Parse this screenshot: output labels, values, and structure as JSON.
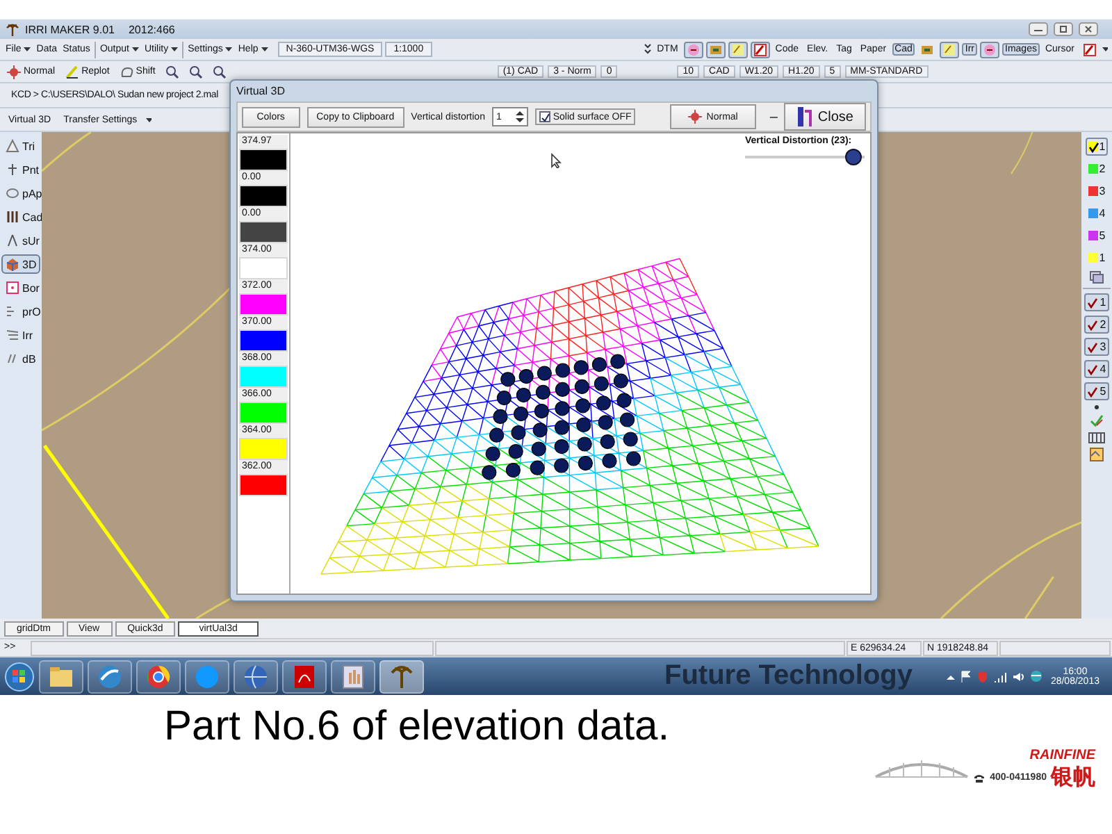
{
  "app": {
    "title": "IRRI MAKER  9.01",
    "build": "2012:466"
  },
  "menus": [
    {
      "label": "File",
      "dropdown": true
    },
    {
      "label": "Data",
      "dropdown": false
    },
    {
      "label": "Status",
      "dropdown": false
    },
    {
      "label": "Output",
      "dropdown": true
    },
    {
      "label": "Utility",
      "dropdown": true
    },
    {
      "label": "Settings",
      "dropdown": true
    },
    {
      "label": "Help",
      "dropdown": true
    }
  ],
  "menu_fields": [
    "N-360-UTM36-WGS",
    "1:1000"
  ],
  "menu_tools": [
    {
      "kind": "text",
      "label": "DTM",
      "pressed": false
    },
    {
      "kind": "tool",
      "pressed": true
    },
    {
      "kind": "tool",
      "pressed": true
    },
    {
      "kind": "tool",
      "pressed": true
    },
    {
      "kind": "tool",
      "pressed": true
    },
    {
      "kind": "text",
      "label": "Code",
      "pressed": false
    },
    {
      "kind": "text",
      "label": "Elev.",
      "pressed": false
    },
    {
      "kind": "text",
      "label": "Tag",
      "pressed": false
    },
    {
      "kind": "text",
      "label": "Paper",
      "pressed": false
    },
    {
      "kind": "text",
      "label": "Cad",
      "pressed": true
    },
    {
      "kind": "tool",
      "pressed": false
    },
    {
      "kind": "tool",
      "pressed": true
    },
    {
      "kind": "text",
      "label": "Irr",
      "pressed": true
    },
    {
      "kind": "tool",
      "pressed": true
    },
    {
      "kind": "text",
      "label": "Images",
      "pressed": true
    },
    {
      "kind": "text",
      "label": "Cursor",
      "pressed": false
    },
    {
      "kind": "tool",
      "pressed": false
    }
  ],
  "toolbar": [
    {
      "kind": "button",
      "label": "Normal"
    },
    {
      "kind": "button",
      "label": "Replot"
    },
    {
      "kind": "button",
      "label": "Shift"
    },
    {
      "kind": "tool"
    },
    {
      "kind": "tool"
    },
    {
      "kind": "tool"
    },
    {
      "kind": "text",
      "label": "(1) CAD"
    },
    {
      "kind": "text",
      "label": "3 - Norm"
    },
    {
      "kind": "text",
      "label": "0"
    },
    {
      "kind": "text",
      "label": "10"
    },
    {
      "kind": "text",
      "label": "CAD"
    },
    {
      "kind": "text",
      "label": "W1.20"
    },
    {
      "kind": "text",
      "label": "H1.20"
    },
    {
      "kind": "text",
      "label": "5"
    },
    {
      "kind": "text",
      "label": "MM-STANDARD"
    }
  ],
  "path": "KCD > C:\\USERS\\DALO\\ Sudan new project 2.mal",
  "tabs": [
    {
      "label": "Virtual 3D"
    },
    {
      "label": "Transfer Settings"
    }
  ],
  "tools": [
    {
      "label": "Tri",
      "selected": false
    },
    {
      "label": "Pnt",
      "selected": false
    },
    {
      "label": "pAp",
      "selected": false
    },
    {
      "label": "Cad",
      "selected": false
    },
    {
      "label": "sUr",
      "selected": false
    },
    {
      "label": "3D",
      "selected": true
    },
    {
      "label": "Bor",
      "selected": false
    },
    {
      "label": "prO",
      "selected": false
    },
    {
      "label": "Irr",
      "selected": false
    },
    {
      "label": "dB",
      "selected": false
    }
  ],
  "layers": [
    {
      "label": "1",
      "color": "#ffff00",
      "checked": true
    },
    {
      "label": "2",
      "color": "#33ee33"
    },
    {
      "label": "3",
      "color": "#ee3333"
    },
    {
      "label": "4",
      "color": "#3399ee"
    },
    {
      "label": "5",
      "color": "#cc33ee"
    },
    {
      "label": "1",
      "color": "#ffff33"
    }
  ],
  "checks": [
    {
      "label": "1",
      "checked": true
    },
    {
      "label": "2",
      "checked": true
    },
    {
      "label": "3",
      "checked": true
    },
    {
      "label": "4",
      "checked": true
    },
    {
      "label": "5",
      "checked": true
    }
  ],
  "dialog": {
    "title": "Virtual 3D",
    "buttons": [
      "Colors",
      "Copy to Clipboard"
    ],
    "distortion_label": "Vertical distortion",
    "distortion_value": "1",
    "solid": {
      "label": "Solid surface OFF",
      "checked": true
    },
    "normal": "Normal",
    "minimize": "–",
    "close": "Close",
    "legend": [
      {
        "value": "374.97",
        "color": "#000000"
      },
      {
        "value": "0.00",
        "color": "#000000"
      },
      {
        "value": "0.00",
        "color": "#444444"
      },
      {
        "value": "374.00",
        "color": "#ffffff"
      },
      {
        "value": "372.00",
        "color": "#ff00ff"
      },
      {
        "value": "370.00",
        "color": "#0000ff"
      },
      {
        "value": "368.00",
        "color": "#00ffff"
      },
      {
        "value": "366.00",
        "color": "#00ff00"
      },
      {
        "value": "364.00",
        "color": "#ffff00"
      },
      {
        "value": "362.00",
        "color": "#ff0000"
      }
    ],
    "slider": {
      "label": "Vertical Distortion (23):",
      "level": 0.97
    }
  },
  "bottom_tabs": [
    {
      "label": "gridDtm",
      "selected": false
    },
    {
      "label": "View",
      "selected": false
    },
    {
      "label": "Quick3d",
      "selected": false
    },
    {
      "label": "virtUal3d",
      "selected": true
    }
  ],
  "status": {
    "prompt": ">>",
    "easting": "E 629634.24",
    "northing": "N 1918248.84"
  },
  "taskbar": {
    "wallpaper_text": "Future Technology",
    "time": "16:00",
    "date": "28/08/2013"
  },
  "caption": "Part No.6 of elevation data.",
  "logo": {
    "brand": "RAINFINE",
    "phone": "400-0411980",
    "chinese": "银帆"
  }
}
